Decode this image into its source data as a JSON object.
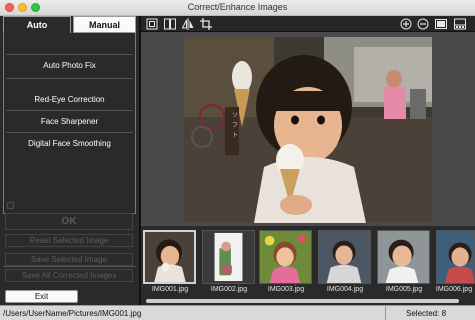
{
  "window": {
    "title": "Correct/Enhance Images"
  },
  "tabs": [
    {
      "label": "Auto"
    },
    {
      "label": "Manual"
    }
  ],
  "menu": {
    "items": [
      {
        "label": "Auto Photo Fix"
      },
      {
        "label": "Red-Eye Correction"
      },
      {
        "label": "Face Sharpener"
      },
      {
        "label": "Digital Face Smoothing"
      }
    ]
  },
  "buttons": {
    "ok": "OK",
    "reset_selected": "Reset Selected Image",
    "save_selected": "Save Selected Image",
    "save_all": "Save All Corrected Images",
    "exit": "Exit"
  },
  "toolbar": {
    "icons": [
      "fit-view-icon",
      "compare-view-icon",
      "flip-icon",
      "crop-icon",
      "zoom-in-icon",
      "zoom-out-icon",
      "full-screen-icon",
      "list-view-icon"
    ]
  },
  "thumbnails": [
    {
      "label": "IMG001.jpg",
      "selected": true
    },
    {
      "label": "IMG002.jpg",
      "selected": false
    },
    {
      "label": "IMG003.jpg",
      "selected": false
    },
    {
      "label": "IMG004.jpg",
      "selected": false
    },
    {
      "label": "IMG005.jpg",
      "selected": false
    },
    {
      "label": "IMG006.jpg",
      "selected": false
    }
  ],
  "status": {
    "path": "/Users/UserName/Pictures/IMG001.jpg",
    "selected": "Selected: 8"
  },
  "colors": {
    "panel": "#2a2a2a",
    "preview_bg": "#4a4a4a",
    "status_bg": "#d9d9d9"
  }
}
